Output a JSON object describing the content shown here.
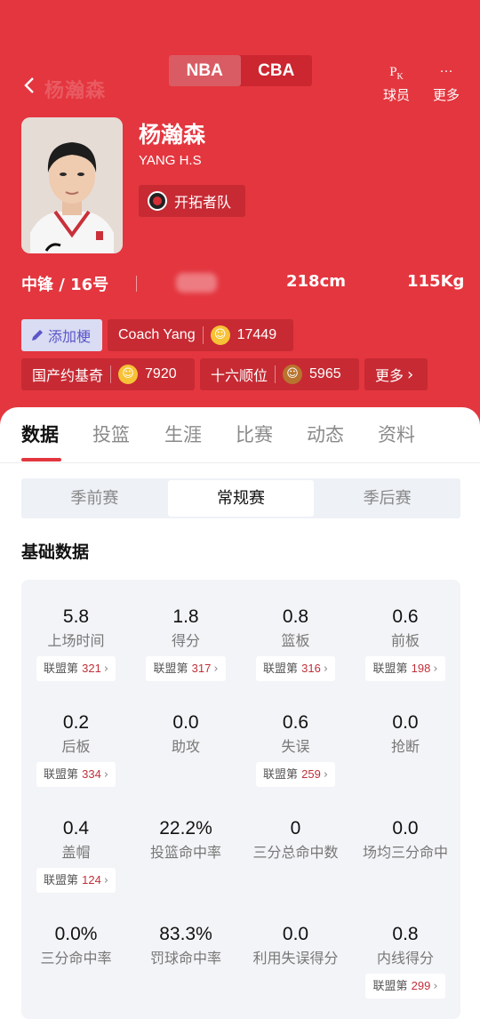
{
  "header": {
    "ghost_name": "杨瀚森",
    "leagues": [
      "NBA",
      "CBA"
    ],
    "actions": [
      {
        "icon": "pk-icon",
        "glyph": "PK",
        "label": "球员"
      },
      {
        "icon": "more-icon",
        "glyph": "···",
        "label": "更多"
      }
    ]
  },
  "player": {
    "name": "杨瀚森",
    "english_name": "YANG H.S",
    "team": "开拓者队",
    "position_number": "中锋 / 16号",
    "height": "218cm",
    "weight": "115Kg"
  },
  "chips": {
    "add_label": "添加梗",
    "nicknames": [
      {
        "text": "Coach Yang",
        "count": "17449"
      },
      {
        "text": "国产约基奇",
        "count": "7920"
      },
      {
        "text": "十六顺位",
        "count": "5965"
      }
    ],
    "more_label": "更多",
    "more_arrow": "›"
  },
  "tabs": [
    "数据",
    "投篮",
    "生涯",
    "比赛",
    "动态",
    "资料"
  ],
  "segments": [
    "季前赛",
    "常规赛",
    "季后赛"
  ],
  "section_title": "基础数据",
  "rank_prefix": "联盟第",
  "rank_arrow": "›",
  "stats": [
    {
      "value": "5.8",
      "label": "上场时间",
      "rank": "321"
    },
    {
      "value": "1.8",
      "label": "得分",
      "rank": "317"
    },
    {
      "value": "0.8",
      "label": "篮板",
      "rank": "316"
    },
    {
      "value": "0.6",
      "label": "前板",
      "rank": "198"
    },
    {
      "value": "0.2",
      "label": "后板",
      "rank": "334"
    },
    {
      "value": "0.0",
      "label": "助攻",
      "rank": ""
    },
    {
      "value": "0.6",
      "label": "失误",
      "rank": "259"
    },
    {
      "value": "0.0",
      "label": "抢断",
      "rank": ""
    },
    {
      "value": "0.4",
      "label": "盖帽",
      "rank": "124"
    },
    {
      "value": "22.2%",
      "label": "投篮命中率",
      "rank": ""
    },
    {
      "value": "0",
      "label": "三分总命中数",
      "rank": ""
    },
    {
      "value": "0.0",
      "label": "场均三分命中",
      "rank": ""
    },
    {
      "value": "0.0%",
      "label": "三分命中率",
      "rank": ""
    },
    {
      "value": "83.3%",
      "label": "罚球命中率",
      "rank": ""
    },
    {
      "value": "0.0",
      "label": "利用失误得分",
      "rank": ""
    },
    {
      "value": "0.8",
      "label": "内线得分",
      "rank": "299"
    }
  ]
}
